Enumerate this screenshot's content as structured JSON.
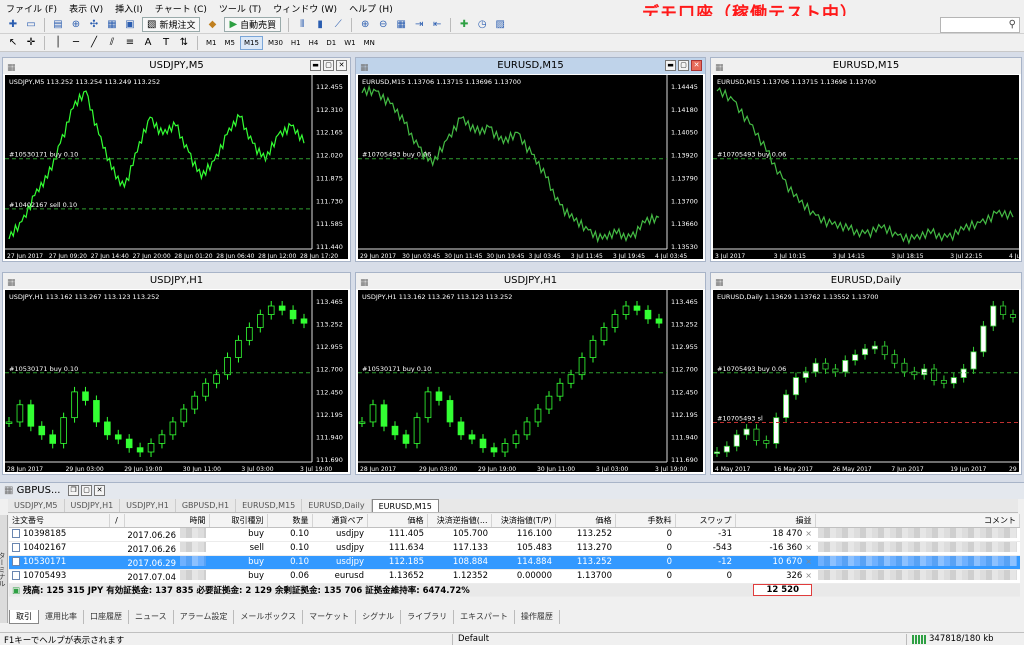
{
  "menu": [
    "ファイル (F)",
    "表示 (V)",
    "挿入(I)",
    "チャート (C)",
    "ツール (T)",
    "ウィンドウ (W)",
    "ヘルプ (H)"
  ],
  "banner": "デモ口座（稼働テスト中）",
  "toolbar": {
    "new_order": "新規注文",
    "auto_trading": "自動売買",
    "timeframes": [
      "M1",
      "M5",
      "M15",
      "M30",
      "H1",
      "H4",
      "D1",
      "W1",
      "MN"
    ],
    "active_timeframe": "M15"
  },
  "charts": [
    {
      "title": "USDJPY,M5",
      "info": "USDJPY,M5 113.252 113.254 113.249 113.252",
      "color": "#33ff33",
      "type": "line",
      "price_labels": [
        "112.455",
        "112.310",
        "112.165",
        "112.020",
        "111.875",
        "111.730",
        "111.585",
        "111.440"
      ],
      "time_labels": [
        "27 Jun 2017",
        "27 Jun 09:20",
        "27 Jun 14:40",
        "27 Jun 20:00",
        "28 Jun 01:20",
        "28 Jun 06:40",
        "28 Jun 12:00",
        "28 Jun 17:20"
      ],
      "orders": [
        "#10530171 buy 0.10",
        "#10402167 sell 0.10"
      ],
      "series": [
        111.6,
        111.7,
        111.85,
        111.95,
        112.15,
        112.35,
        112.45,
        112.2,
        112.0,
        111.9,
        112.1,
        112.3,
        112.2,
        112.25,
        112.1,
        111.95,
        112.05,
        112.2,
        112.3,
        112.15,
        112.05,
        112.2,
        112.25,
        112.15
      ]
    },
    {
      "title": "EURUSD,M15",
      "info": "EURUSD,M15 1.13706 1.13715 1.13696 1.13700",
      "color": "#44bb44",
      "type": "line",
      "active": true,
      "price_labels": [
        "1.14445",
        "1.14180",
        "1.14050",
        "1.13920",
        "1.13790",
        "1.13700",
        "1.13660",
        "1.13530"
      ],
      "time_labels": [
        "29 Jun 2017",
        "30 Jun 03:45",
        "30 Jun 11:45",
        "30 Jun 19:45",
        "3 Jul 03:45",
        "3 Jul 11:45",
        "3 Jul 19:45",
        "4 Jul 03:45"
      ],
      "orders": [
        "#10705493 buy 0.06"
      ],
      "series": [
        1.1442,
        1.1443,
        1.1436,
        1.1425,
        1.1412,
        1.1402,
        1.1416,
        1.1428,
        1.142,
        1.1423,
        1.1414,
        1.142,
        1.1408,
        1.1395,
        1.138,
        1.1371,
        1.1366,
        1.1361,
        1.1364,
        1.1362,
        1.137,
        1.1373
      ]
    },
    {
      "title": "EURUSD,M15",
      "info": "EURUSD,M15 1.13706 1.13715 1.13696 1.13700",
      "color": "#44bb44",
      "type": "line",
      "price_labels": [],
      "time_labels": [
        "3 Jul 2017",
        "3 Jul 10:15",
        "3 Jul 14:15",
        "3 Jul 18:15",
        "3 Jul 22:15",
        "4 Jul 02:15"
      ],
      "orders": [
        "#10705493 buy 0.06"
      ],
      "series": [
        1.1443,
        1.1438,
        1.1425,
        1.141,
        1.1395,
        1.1382,
        1.1375,
        1.137,
        1.1367,
        1.1365,
        1.1368,
        1.1364,
        1.1362,
        1.1365,
        1.1363,
        1.1367,
        1.1371,
        1.1376,
        1.1374
      ]
    },
    {
      "title": "USDJPY,H1",
      "info": "USDJPY,H1 113.162 113.267 113.123 113.252",
      "color": "#33ff33",
      "type": "candle",
      "price_labels": [
        "113.465",
        "113.252",
        "112.955",
        "112.700",
        "112.450",
        "112.195",
        "111.940",
        "111.690"
      ],
      "time_labels": [
        "28 Jun 2017",
        "29 Jun 03:00",
        "29 Jun 19:00",
        "30 Jun 11:00",
        "3 Jul 03:00",
        "3 Jul 19:00"
      ],
      "orders": [
        "#10530171 buy 0.10"
      ],
      "series": [
        112.1,
        112.3,
        112.05,
        111.95,
        111.85,
        112.15,
        112.45,
        112.35,
        112.1,
        111.95,
        111.9,
        111.8,
        111.75,
        111.85,
        111.95,
        112.1,
        112.25,
        112.4,
        112.55,
        112.65,
        112.85,
        113.05,
        113.2,
        113.35,
        113.45,
        113.4,
        113.3,
        113.25
      ]
    },
    {
      "title": "USDJPY,H1",
      "info": "USDJPY,H1 113.162 113.267 113.123 113.252",
      "color": "#33ff33",
      "type": "candle",
      "price_labels": [
        "113.465",
        "113.252",
        "112.955",
        "112.700",
        "112.450",
        "112.195",
        "111.940",
        "111.690"
      ],
      "time_labels": [
        "28 Jun 2017",
        "29 Jun 03:00",
        "29 Jun 19:00",
        "30 Jun 11:00",
        "3 Jul 03:00",
        "3 Jul 19:00"
      ],
      "orders": [
        "#10530171 buy 0.10"
      ],
      "series": [
        112.1,
        112.3,
        112.05,
        111.95,
        111.85,
        112.15,
        112.45,
        112.35,
        112.1,
        111.95,
        111.9,
        111.8,
        111.75,
        111.85,
        111.95,
        112.1,
        112.25,
        112.4,
        112.55,
        112.65,
        112.85,
        113.05,
        113.2,
        113.35,
        113.45,
        113.4,
        113.3,
        113.25
      ]
    },
    {
      "title": "EURUSD,Daily",
      "info": "EURUSD,Daily 1.13629 1.13762 1.13552 1.13700",
      "color": "#ffffff",
      "type": "candle",
      "price_labels": [],
      "time_labels": [
        "4 May 2017",
        "16 May 2017",
        "26 May 2017",
        "7 Jun 2017",
        "19 Jun 2017",
        "29 Jun 2017"
      ],
      "orders": [
        "#10705493 buy 0.06",
        "#10705493 sl"
      ],
      "series": [
        1.09,
        1.092,
        1.096,
        1.098,
        1.094,
        1.093,
        1.102,
        1.11,
        1.116,
        1.118,
        1.121,
        1.119,
        1.118,
        1.122,
        1.124,
        1.126,
        1.127,
        1.124,
        1.121,
        1.118,
        1.117,
        1.119,
        1.115,
        1.114,
        1.116,
        1.119,
        1.125,
        1.134,
        1.141,
        1.138,
        1.137
      ]
    }
  ],
  "terminal": {
    "title": "GBPUS...",
    "side_tab": "ターミナル",
    "symbol_tabs": [
      "USDJPY,M5",
      "USDJPY,H1",
      "USDJPY,H1",
      "GBPUSD,H1",
      "EURUSD,M15",
      "EURUSD,Daily",
      "EURUSD,M15"
    ],
    "active_symbol_tab": 6,
    "columns": [
      "注文番号",
      "/",
      "時間",
      "取引種別",
      "数量",
      "通貨ペア",
      "価格",
      "決済逆指値(...",
      "決済指値(T/P)",
      "価格",
      "手数料",
      "スワップ",
      "損益",
      "コメント"
    ],
    "orders": [
      {
        "ticket": "10398185",
        "time": "2017.06.26",
        "type": "buy",
        "volume": "0.10",
        "symbol": "usdjpy",
        "price": "111.405",
        "sl": "105.700",
        "tp": "116.100",
        "current": "113.252",
        "commission": "0",
        "swap": "-31",
        "profit": "18 470"
      },
      {
        "ticket": "10402167",
        "time": "2017.06.26",
        "type": "sell",
        "volume": "0.10",
        "symbol": "usdjpy",
        "price": "111.634",
        "sl": "117.133",
        "tp": "105.483",
        "current": "113.270",
        "commission": "0",
        "swap": "-543",
        "profit": "-16 360"
      },
      {
        "ticket": "10530171",
        "time": "2017.06.29",
        "type": "buy",
        "volume": "0.10",
        "symbol": "usdjpy",
        "price": "112.185",
        "sl": "108.884",
        "tp": "114.884",
        "current": "113.252",
        "commission": "0",
        "swap": "-12",
        "profit": "10 670",
        "selected": true
      },
      {
        "ticket": "10705493",
        "time": "2017.07.04",
        "type": "buy",
        "volume": "0.06",
        "symbol": "eurusd",
        "price": "1.13652",
        "sl": "1.12352",
        "tp": "0.00000",
        "current": "1.13700",
        "commission": "0",
        "swap": "0",
        "profit": "326"
      }
    ],
    "summary": "残高: 125 315 JPY  有効証拠金: 137 835  必要証拠金: 2 129  余剰証拠金: 135 706  証拠金維持率: 6474.72%",
    "total_profit": "12 520",
    "bottom_tabs": [
      "取引",
      "運用比率",
      "口座履歴",
      "ニュース",
      "アラーム設定",
      "メールボックス",
      "マーケット",
      "シグナル",
      "ライブラリ",
      "エキスパート",
      "操作履歴"
    ],
    "active_bottom_tab": 0
  },
  "status": {
    "help": "F1キーでヘルプが表示されます",
    "profile": "Default",
    "connection": "347818/180 kb"
  },
  "colors": {
    "banner": "#ff1a1a",
    "selected_row": "#3399ff",
    "order_line": "#2f9e2f",
    "sl_line": "#c03030"
  }
}
